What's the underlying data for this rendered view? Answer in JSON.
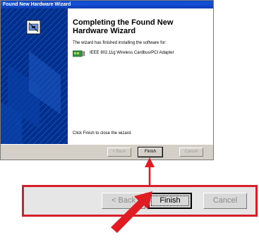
{
  "window": {
    "title": "Found New Hardware Wizard",
    "heading_line1": "Completing the Found New",
    "heading_line2": "Hardware Wizard",
    "body_text": "The wizard has finished installing the software for:",
    "device_name": "IEEE 802.11g Wireless Cardbus/PCI Adapter",
    "device_icon": "network-adapter-icon",
    "close_hint": "Click Finish to close the wizard."
  },
  "buttons": {
    "back_label": "< Back",
    "finish_label": "Finish",
    "cancel_label": "Cancel"
  },
  "callout": {
    "back_label": "< Back",
    "finish_label": "Finish",
    "cancel_label": "Cancel",
    "border_color": "#d91e2b"
  },
  "colors": {
    "titlebar": "#0b47c9",
    "banner": "#003090",
    "button_face": "#d4d0c8",
    "arrow": "#e01b22"
  }
}
